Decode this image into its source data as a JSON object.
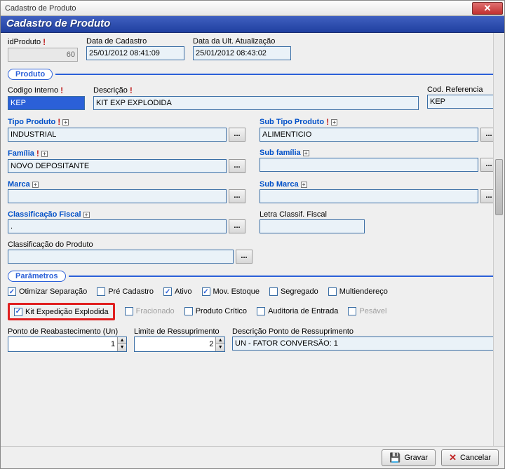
{
  "window": {
    "title": "Cadastro de Produto"
  },
  "header": {
    "inner_title": "Cadastro de Produto"
  },
  "top": {
    "id_label": "idProduto",
    "id_value": "60",
    "cad_label": "Data de Cadastro",
    "cad_value": "25/01/2012 08:41:09",
    "upd_label": "Data da Ult. Atualização",
    "upd_value": "25/01/2012 08:43:02"
  },
  "sec_produto": "Produto",
  "produto": {
    "codigo_interno_label": "Codigo Interno",
    "codigo_interno_value": "KEP",
    "descricao_label": "Descrição",
    "descricao_value": "KIT EXP EXPLODIDA",
    "cod_ref_label": "Cod. Referencia",
    "cod_ref_value": "KEP",
    "tipo_label": "Tipo Produto",
    "tipo_value": "INDUSTRIAL",
    "subtipo_label": "Sub Tipo Produto",
    "subtipo_value": "ALIMENTICIO",
    "familia_label": "Família",
    "familia_value": "NOVO DEPOSITANTE",
    "subfamilia_label": "Sub família",
    "subfamilia_value": "",
    "marca_label": "Marca",
    "marca_value": "",
    "submarca_label": "Sub Marca",
    "submarca_value": "",
    "classif_fiscal_label": "Classificação Fiscal",
    "classif_fiscal_value": ".",
    "letra_classif_label": "Letra Classif. Fiscal",
    "letra_classif_value": "",
    "classif_prod_label": "Classificação do Produto",
    "classif_prod_value": ""
  },
  "sec_param": "Parâmetros",
  "chk": {
    "otimizar": "Otimizar Separação",
    "pre_cad": "Pré Cadastro",
    "ativo": "Ativo",
    "mov_est": "Mov. Estoque",
    "segregado": "Segregado",
    "multiend": "Multiendereço",
    "kit": "Kit Expedição Explodida",
    "fracionado": "Fracionado",
    "prod_crit": "Produto Crítico",
    "aud_entrada": "Auditoria de Entrada",
    "pesavel": "Pesável"
  },
  "bottom": {
    "ponto_reab_label": "Ponto de Reabastecimento (Un)",
    "ponto_reab_value": "1",
    "limite_label": "Limite de Ressuprimento",
    "limite_value": "2",
    "desc_ponto_label": "Descrição Ponto de Ressuprimento",
    "desc_ponto_value": "UN - FATOR CONVERSÃO: 1"
  },
  "footer": {
    "gravar": "Gravar",
    "cancelar": "Cancelar"
  }
}
